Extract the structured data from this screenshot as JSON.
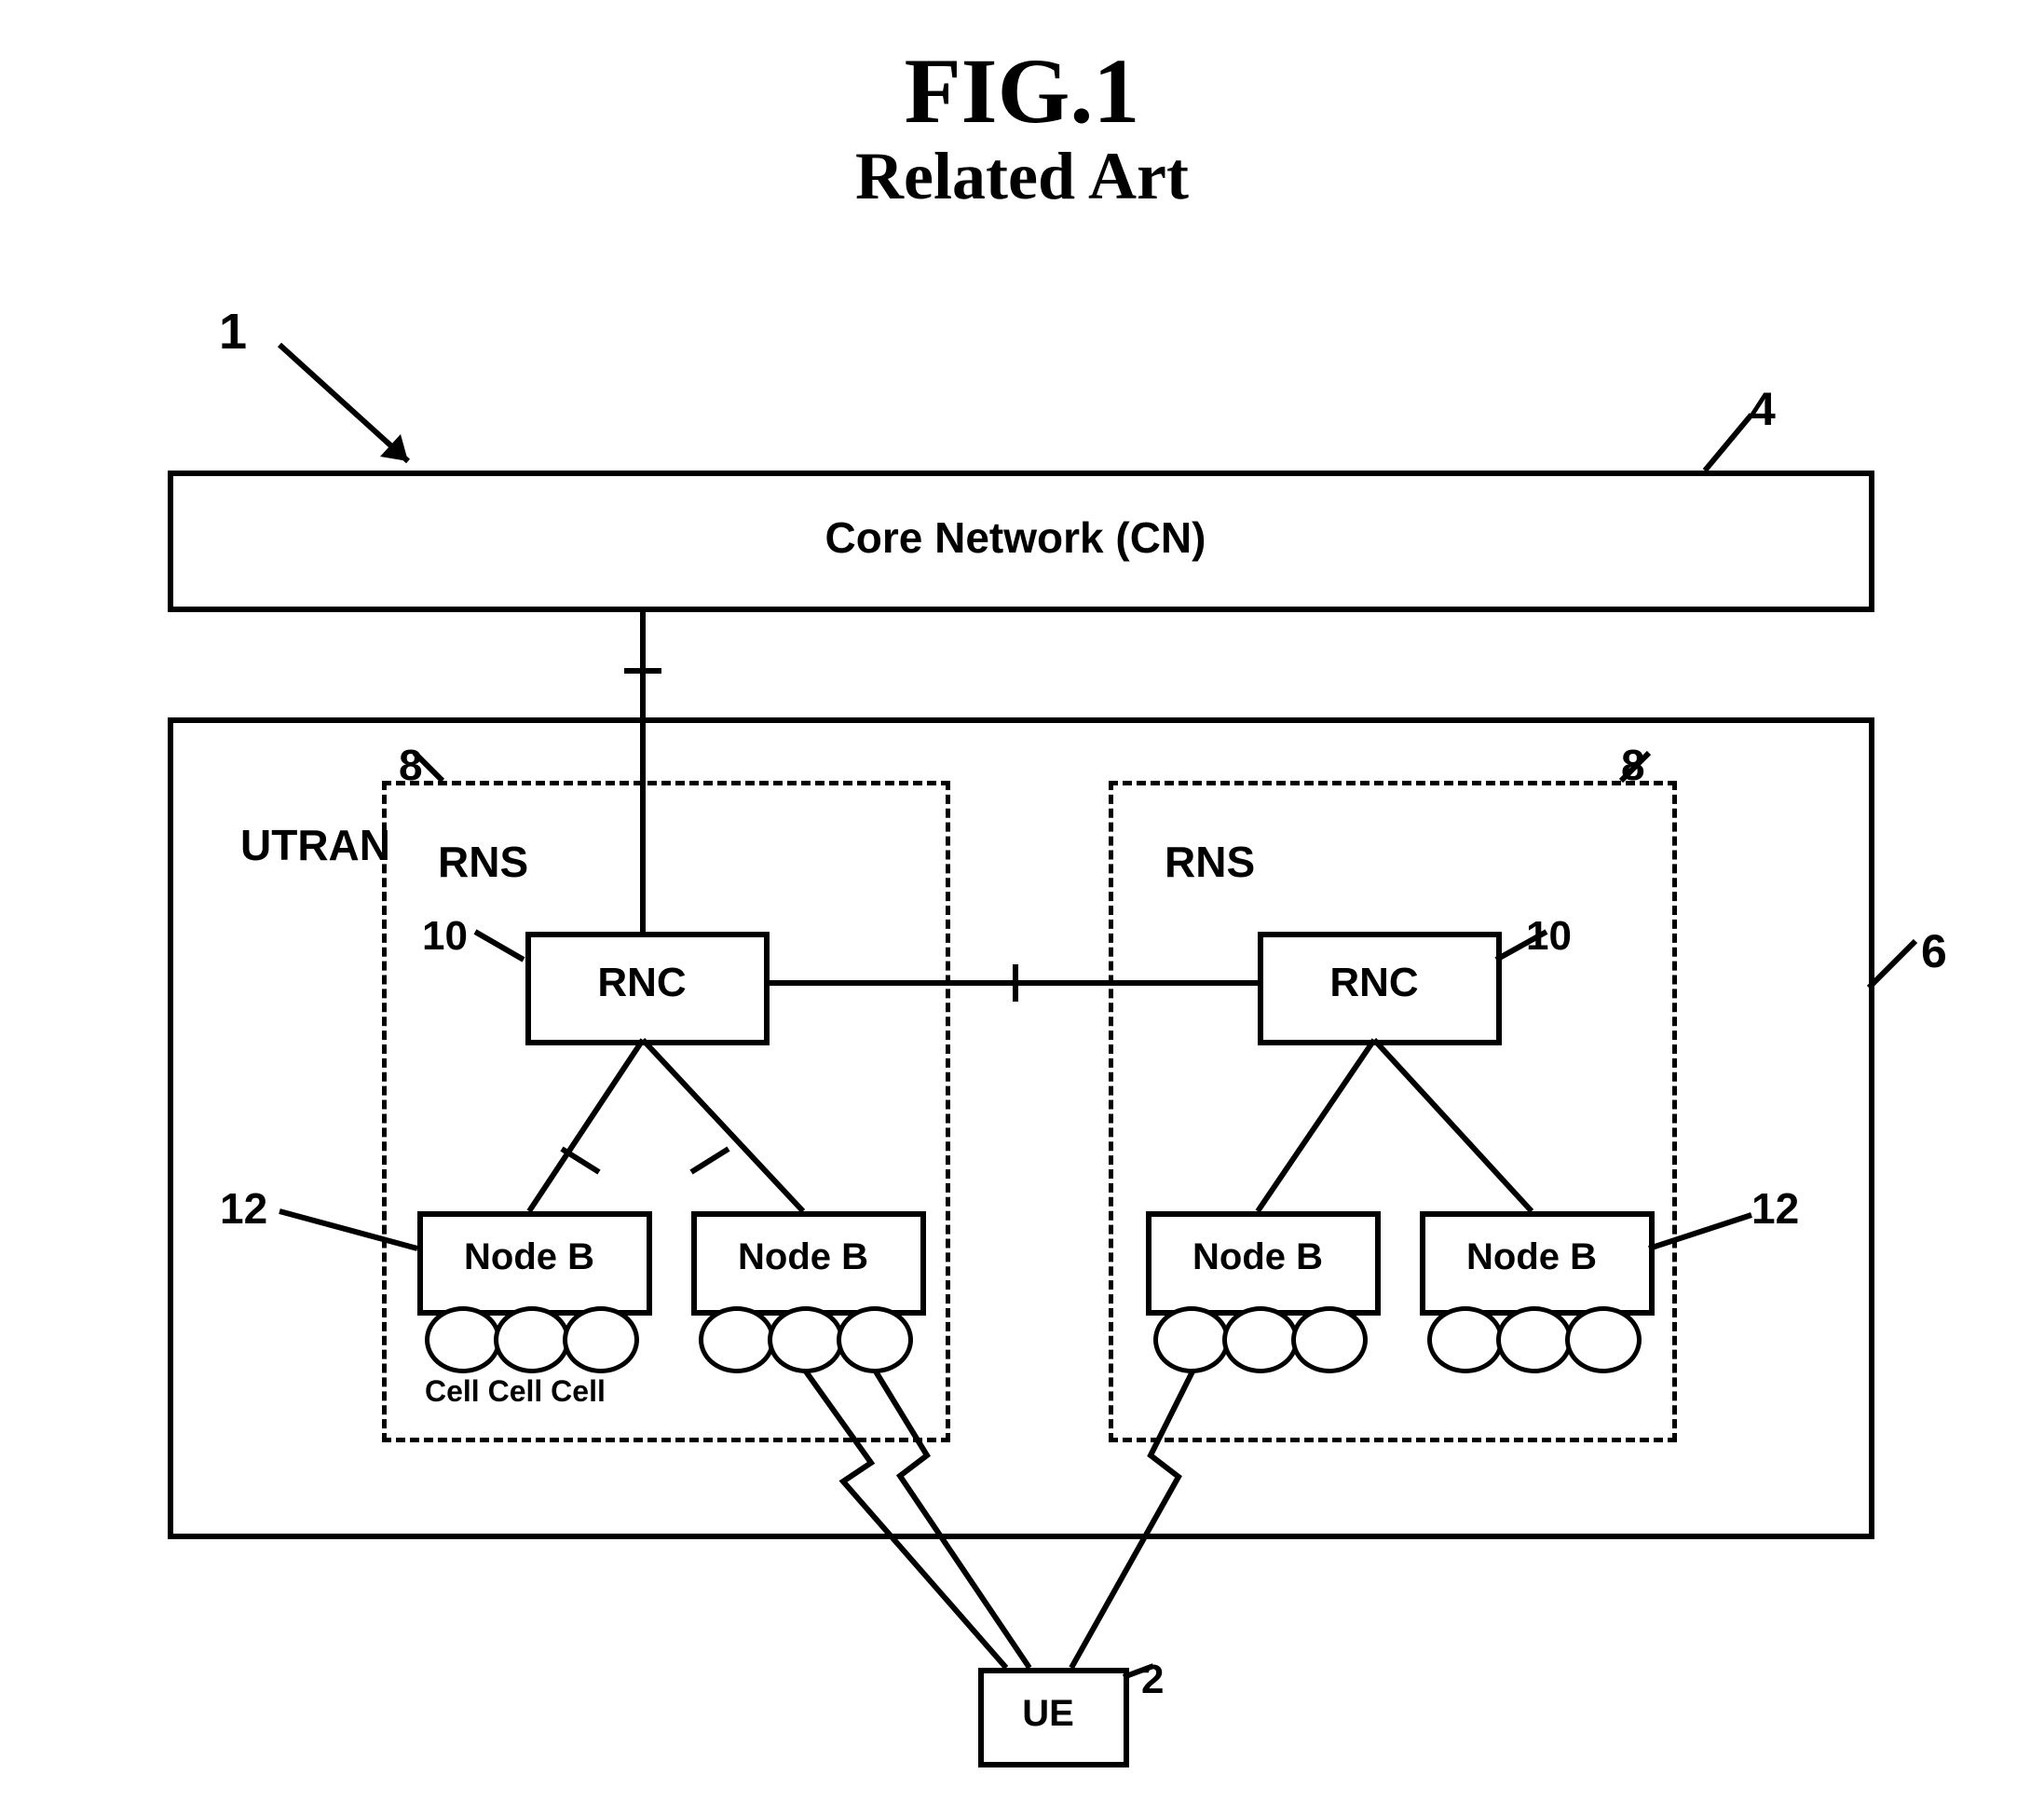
{
  "fig_title": "FIG.1",
  "fig_subtitle": "Related Art",
  "ref1": "1",
  "ref4": "4",
  "ref6": "6",
  "ref8": "8",
  "ref10": "10",
  "ref12": "12",
  "ref2": "2",
  "cn_label": "Core Network (CN)",
  "utran_label": "UTRAN",
  "rns_label": "RNS",
  "rnc_label": "RNC",
  "nodeb_label": "Node B",
  "ue_label": "UE",
  "cells_label": "Cell  Cell  Cell"
}
